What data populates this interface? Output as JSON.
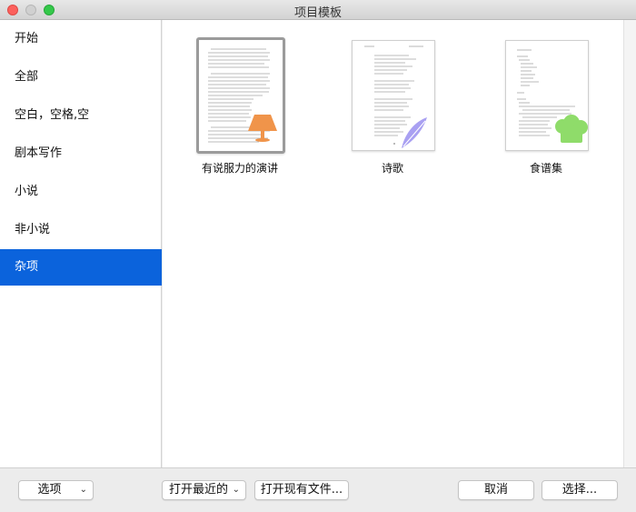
{
  "window": {
    "title": "项目模板"
  },
  "sidebar": {
    "items": [
      {
        "label": "开始"
      },
      {
        "label": "全部"
      },
      {
        "label": "空白，空格,空"
      },
      {
        "label": "剧本写作"
      },
      {
        "label": "小说"
      },
      {
        "label": "非小说"
      },
      {
        "label": "杂项",
        "selected": true
      }
    ]
  },
  "templates": [
    {
      "label": "有说服力的演讲",
      "icon": "lamp-icon",
      "selected": true
    },
    {
      "label": "诗歌",
      "icon": "feather-quill-icon"
    },
    {
      "label": "食谱集",
      "icon": "chef-hat-icon"
    }
  ],
  "footer": {
    "options_label": "选项",
    "open_recent_label": "打开最近的",
    "open_existing_label": "打开现有文件...",
    "cancel_label": "取消",
    "choose_label": "选择..."
  },
  "colors": {
    "selection": "#0b63dc",
    "lamp": "#f0944a",
    "feather": "#a9a0f2",
    "chef_hat": "#8fdc6a"
  }
}
